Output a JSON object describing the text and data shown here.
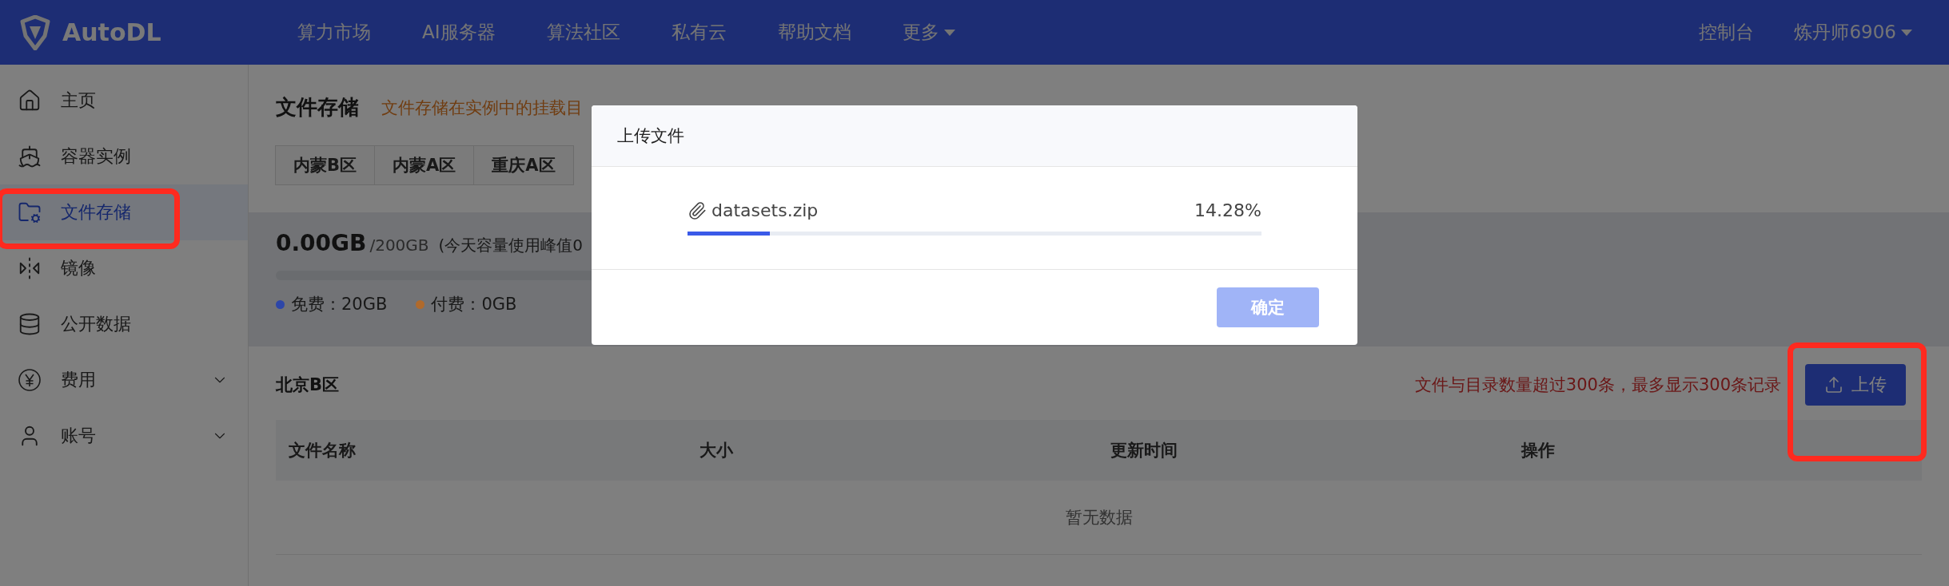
{
  "header": {
    "logo": "AutoDL",
    "nav": [
      {
        "label": "算力市场",
        "dropdown": false
      },
      {
        "label": "AI服务器",
        "dropdown": false
      },
      {
        "label": "算法社区",
        "dropdown": false
      },
      {
        "label": "私有云",
        "dropdown": false
      },
      {
        "label": "帮助文档",
        "dropdown": false
      },
      {
        "label": "更多",
        "dropdown": true
      }
    ],
    "console": "控制台",
    "user": "炼丹师6906"
  },
  "sidebar": {
    "items": [
      {
        "kind": "home",
        "label": "主页",
        "selected": false,
        "expandable": false,
        "highlighted": false
      },
      {
        "kind": "ship",
        "label": "容器实例",
        "selected": false,
        "expandable": false,
        "highlighted": false
      },
      {
        "kind": "folder",
        "label": "文件存储",
        "selected": true,
        "expandable": false,
        "highlighted": true
      },
      {
        "kind": "mirror",
        "label": "镜像",
        "selected": false,
        "expandable": false,
        "highlighted": false
      },
      {
        "kind": "database",
        "label": "公开数据",
        "selected": false,
        "expandable": false,
        "highlighted": false
      },
      {
        "kind": "yen",
        "label": "费用",
        "selected": false,
        "expandable": true,
        "highlighted": false
      },
      {
        "kind": "user",
        "label": "账号",
        "selected": false,
        "expandable": true,
        "highlighted": false
      }
    ]
  },
  "page": {
    "title": "文件存储",
    "notice": "文件存储在实例中的挂载目",
    "regions": [
      {
        "label": "内蒙B区",
        "selected": false
      },
      {
        "label": "内蒙A区",
        "selected": false
      },
      {
        "label": "重庆A区",
        "selected": false
      }
    ],
    "usage": {
      "used": "0.00GB",
      "total": "/200GB",
      "note": "(今天容量使用峰值0",
      "level": 0
    },
    "legend": [
      {
        "label": "免费：20GB",
        "color": "#2d46a8"
      },
      {
        "label": "付费：0GB",
        "color": "#b06a2c"
      }
    ],
    "region_title": "北京B区",
    "limit_notice": "文件与目录数量超过300条，最多显示300条记录",
    "upload_button": "上传",
    "upload_highlighted": true,
    "table": {
      "columns": [
        "文件名称",
        "大小",
        "更新时间",
        "操作"
      ],
      "empty": "暂无数据"
    }
  },
  "dialog": {
    "title": "上传文件",
    "file": {
      "name": "datasets.zip",
      "percent": "14.28%",
      "level": 0.1428
    },
    "confirm": {
      "label": "确定",
      "disabled": true
    }
  }
}
